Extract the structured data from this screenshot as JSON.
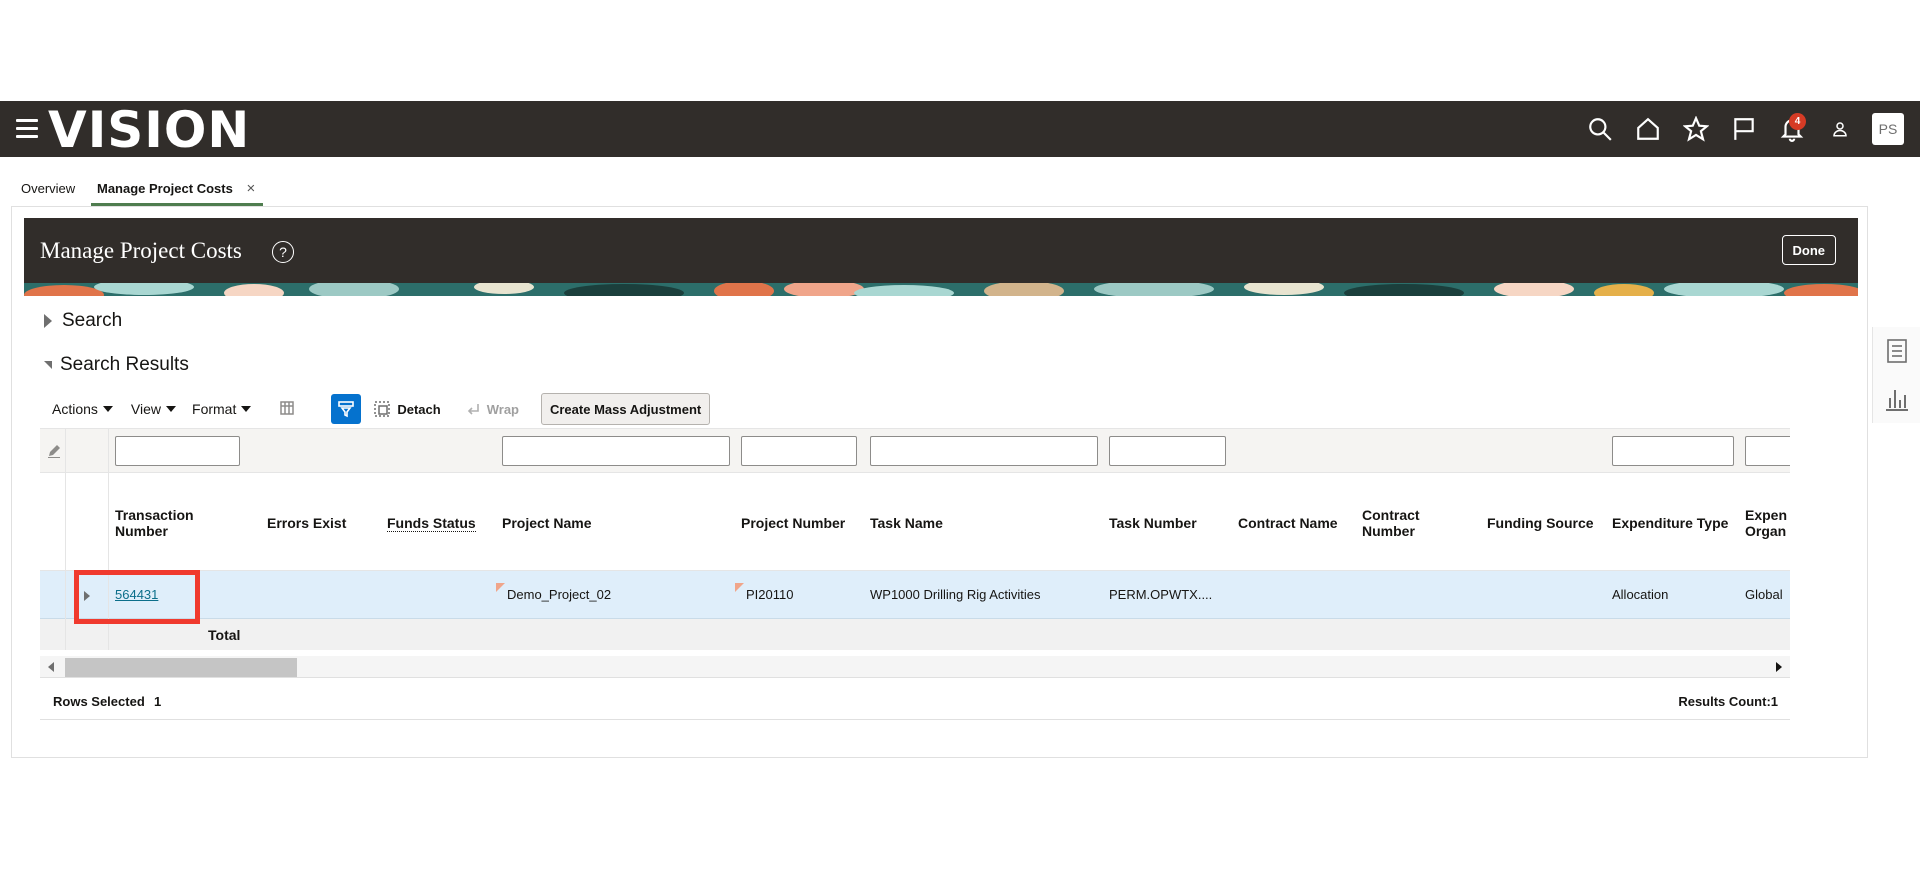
{
  "app": {
    "logo_text": "VISION",
    "notification_count": "4",
    "user_initials": "PS"
  },
  "tabs": {
    "overview_label": "Overview",
    "active_label": "Manage Project Costs",
    "close_glyph": "×"
  },
  "page": {
    "title": "Manage Project Costs",
    "help_glyph": "?",
    "done_label": "Done"
  },
  "sections": {
    "search_label": "Search",
    "results_label": "Search Results"
  },
  "toolbar": {
    "actions_label": "Actions",
    "view_label": "View",
    "format_label": "Format",
    "detach_label": "Detach",
    "wrap_label": "Wrap",
    "mass_adjust_label": "Create Mass Adjustment"
  },
  "table": {
    "columns": {
      "transaction_number": "Transaction Number",
      "errors_exist": "Errors Exist",
      "funds_status": "Funds Status",
      "project_name": "Project Name",
      "project_number": "Project Number",
      "task_name": "Task Name",
      "task_number": "Task Number",
      "contract_name": "Contract Name",
      "contract_number": "Contract Number",
      "funding_source": "Funding Source",
      "expenditure_type": "Expenditure Type",
      "expenditure_org": "Expen Organ"
    },
    "row": {
      "transaction_number": "564431",
      "errors_exist": "",
      "funds_status": "",
      "project_name": "Demo_Project_02",
      "project_number": "PI20110",
      "task_name": "WP1000 Drilling Rig Activities",
      "task_number": "PERM.OPWTX....",
      "contract_name": "",
      "contract_number": "",
      "funding_source": "",
      "expenditure_type": "Allocation",
      "expenditure_org": "Global"
    },
    "total_label": "Total"
  },
  "footer": {
    "rows_selected_label": "Rows Selected",
    "rows_selected_count": "1",
    "results_count": "Results Count:1"
  },
  "colors": {
    "topbar": "#312d2a",
    "accent_blue": "#0572ce",
    "selected_row": "#dfeefa",
    "highlight_box": "#f03a2e",
    "tab_underline": "#4f7d4f"
  }
}
